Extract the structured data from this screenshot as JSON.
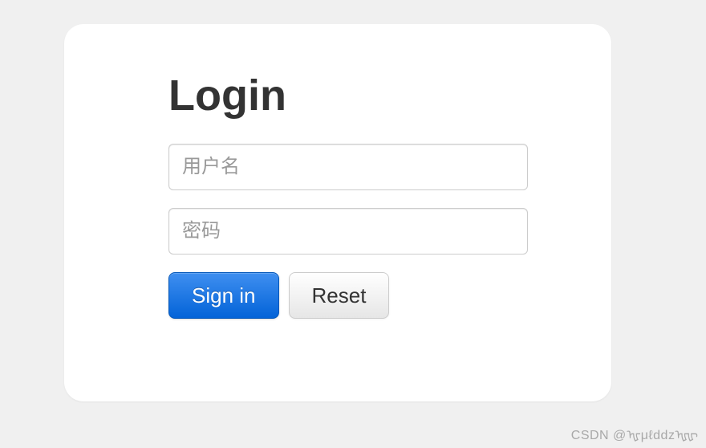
{
  "login": {
    "title": "Login",
    "username_placeholder": "用户名",
    "username_value": "",
    "password_placeholder": "密码",
    "password_value": "",
    "signin_label": "Sign in",
    "reset_label": "Reset"
  },
  "watermark": "CSDN @ᠾμℓddzᠾᠾ"
}
